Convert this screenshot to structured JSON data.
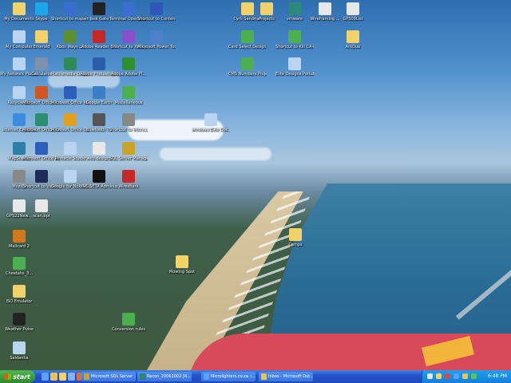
{
  "desktop": {
    "icons": [
      {
        "label": "My Documents",
        "icon": "folder-icon",
        "color": "#f4d26a"
      },
      {
        "label": "Skype",
        "icon": "skype-icon",
        "color": "#1aa7e8"
      },
      {
        "label": "Shortcut to mspaint",
        "icon": "paint-icon",
        "color": "#3a6fd1"
      },
      {
        "label": "Task Gate",
        "icon": "app-icon",
        "color": "#222222"
      },
      {
        "label": "Terminal Operations Sid...",
        "icon": "terminal-icon",
        "color": "#3a6fd1"
      },
      {
        "label": "Shortcut to Content",
        "icon": "shortcut-icon",
        "color": "#2e57b8"
      },
      {
        "label": "Cyril Sandrian",
        "icon": "folder-icon",
        "color": "#f4d26a"
      },
      {
        "label": "Projects",
        "icon": "folder-icon",
        "color": "#f4d26a"
      },
      {
        "label": "vmware",
        "icon": "vmware-icon",
        "color": "#2b8a7e"
      },
      {
        "label": "Wireframing ...",
        "icon": "document-icon",
        "color": "#e8e8e8"
      },
      {
        "label": "GPS09List",
        "icon": "document-icon",
        "color": "#e8e8e8"
      },
      {
        "label": "My Computer",
        "icon": "computer-icon",
        "color": "#b9d3f0"
      },
      {
        "label": "Emerald",
        "icon": "folder-icon",
        "color": "#f4d26a"
      },
      {
        "label": "Xbox Ways Lit",
        "icon": "app-icon",
        "color": "#5b8f2e"
      },
      {
        "label": "Adobe Reader 8.0",
        "icon": "pdf-icon",
        "color": "#c62828"
      },
      {
        "label": "Shortcut to Xdoky",
        "icon": "shortcut-icon",
        "color": "#8a4fc9"
      },
      {
        "label": "Microsoft Power Tools",
        "icon": "tools-icon",
        "color": "#4e7fc9"
      },
      {
        "label": "Card Select Designs",
        "icon": "document-icon",
        "color": "#4caf50"
      },
      {
        "label": "Shortcut to Kill CA-Eldorado",
        "icon": "shortcut-icon",
        "color": "#4caf50"
      },
      {
        "label": "ArkDue",
        "icon": "folder-icon",
        "color": "#f4d26a"
      },
      {
        "label": "My Network Places",
        "icon": "network-icon",
        "color": "#b9d3f0"
      },
      {
        "label": "Calculator",
        "icon": "calculator-icon",
        "color": "#7e8fb2"
      },
      {
        "label": "Macromedia Dreamweav...",
        "icon": "dreamweaver-icon",
        "color": "#2e8b57"
      },
      {
        "label": "Adobe Photoshop CS",
        "icon": "photoshop-icon",
        "color": "#2b5ea8"
      },
      {
        "label": "Adobe Adobe Pl...",
        "icon": "flash-icon",
        "color": "#2f8f2f"
      },
      {
        "label": "CMS Numbers Project",
        "icon": "document-icon",
        "color": "#4caf50"
      },
      {
        "label": "Elite Designs Portal",
        "icon": "document-icon",
        "color": "#b9d3f0"
      },
      {
        "label": "Recycle Bin",
        "icon": "recycle-bin-icon",
        "color": "#b9d3f0"
      },
      {
        "label": "Microsoft Office P...",
        "icon": "powerpoint-icon",
        "color": "#d2571e"
      },
      {
        "label": "Microsoft Office W...",
        "icon": "word-icon",
        "color": "#2c5fb9"
      },
      {
        "label": "Google Earth",
        "icon": "globe-icon",
        "color": "#3a7fc1"
      },
      {
        "label": "Miscellaneous",
        "icon": "document-icon",
        "color": "#4caf50"
      },
      {
        "label": "Internet Explorer",
        "icon": "ie-icon",
        "color": "#3a8ae0"
      },
      {
        "label": "Microsoft Office Publ...",
        "icon": "publisher-icon",
        "color": "#2b8e6e"
      },
      {
        "label": "Microsoft Office Outl...",
        "icon": "outlook-icon",
        "color": "#e0a21e"
      },
      {
        "label": "Bluetooth TV",
        "icon": "app-icon",
        "color": "#555555"
      },
      {
        "label": "Shortcut to Vitcrs.dll",
        "icon": "shortcut-icon",
        "color": "#888888"
      },
      {
        "label": "windows Elite Doc...",
        "icon": "document-icon",
        "color": "#b9d3f0"
      },
      {
        "label": "MapSource",
        "icon": "globe-icon",
        "color": "#2b7fa8"
      },
      {
        "label": "Microsoft Office W...",
        "icon": "word-icon",
        "color": "#2c5fb9"
      },
      {
        "label": "Pinnacle Studio",
        "icon": "document-icon",
        "color": "#b9d3f0"
      },
      {
        "label": "web.designs",
        "icon": "document-icon",
        "color": "#e8e8e8"
      },
      {
        "label": "SQL Server Manageme...",
        "icon": "sql-icon",
        "color": "#c9a227"
      },
      {
        "label": "Mozilla",
        "icon": "computer-icon",
        "color": "#888888"
      },
      {
        "label": "Shortcut to Vsl8Prj",
        "icon": "shortcut-icon",
        "color": "#1d2d5a"
      },
      {
        "label": "Google for Nokia N800",
        "icon": "document-icon",
        "color": "#b9d3f0"
      },
      {
        "label": "VNC SETA Administration",
        "icon": "vnc-icon",
        "color": "#111111"
      },
      {
        "label": "Wireshark",
        "icon": "app-icon",
        "color": "#c62828"
      },
      {
        "label": "GPS22New...",
        "icon": "document-icon",
        "color": "#e8e8e8"
      },
      {
        "label": "scan.bpt",
        "icon": "document-icon",
        "color": "#e8e8e8"
      },
      {
        "label": "Camps",
        "icon": "folder-icon",
        "color": "#f4d26a"
      },
      {
        "label": "Mallcard 2",
        "icon": "app-icon",
        "color": "#d07a1a"
      },
      {
        "label": "Mowing Spot",
        "icon": "folder-icon",
        "color": "#f4d26a"
      },
      {
        "label": "Cheetahs_3...",
        "icon": "document-icon",
        "color": "#4caf50"
      },
      {
        "label": "ISO Emulator",
        "icon": "folder-icon",
        "color": "#f4d26a"
      },
      {
        "label": "Weather Pulse",
        "icon": "weather-icon",
        "color": "#222222"
      },
      {
        "label": "Conversion rules",
        "icon": "document-icon",
        "color": "#4caf50"
      },
      {
        "label": "Saldanha",
        "icon": "document-icon",
        "color": "#b9d3f0"
      }
    ]
  },
  "taskbar": {
    "start_label": "start",
    "quick_launch": [
      {
        "icon": "ie-icon",
        "color": "#5aa0ff"
      },
      {
        "icon": "outlook-icon",
        "color": "#f3c04a"
      },
      {
        "icon": "folder-icon",
        "color": "#f4d26a"
      },
      {
        "icon": "desktop-icon",
        "color": "#7fb3ff"
      },
      {
        "icon": "media-icon",
        "color": "#e06d2e"
      }
    ],
    "tasks": [
      {
        "label": "Microsoft SQL Server ...",
        "icon": "sql-icon",
        "color": "#c9a227"
      },
      {
        "label": "Recon_20061002 [R...",
        "icon": "excel-icon",
        "color": "#2e8b57"
      },
      {
        "label": "Microlighters.co.za ::...",
        "icon": "ie-icon",
        "color": "#5aa0ff"
      },
      {
        "label": "Inbox - Microsoft Out...",
        "icon": "outlook-icon",
        "color": "#f3c04a"
      }
    ],
    "tray_icons": [
      {
        "icon": "network-icon",
        "color": "#e8e8e8"
      },
      {
        "icon": "sound-icon",
        "color": "#f4d26a"
      },
      {
        "icon": "antivirus-icon",
        "color": "#d84a4a"
      },
      {
        "icon": "bluetooth-icon",
        "color": "#5aa0ff"
      },
      {
        "icon": "shield-icon",
        "color": "#f3c04a"
      },
      {
        "icon": "messenger-icon",
        "color": "#5ac45a"
      }
    ],
    "clock": "6:48 PM"
  }
}
